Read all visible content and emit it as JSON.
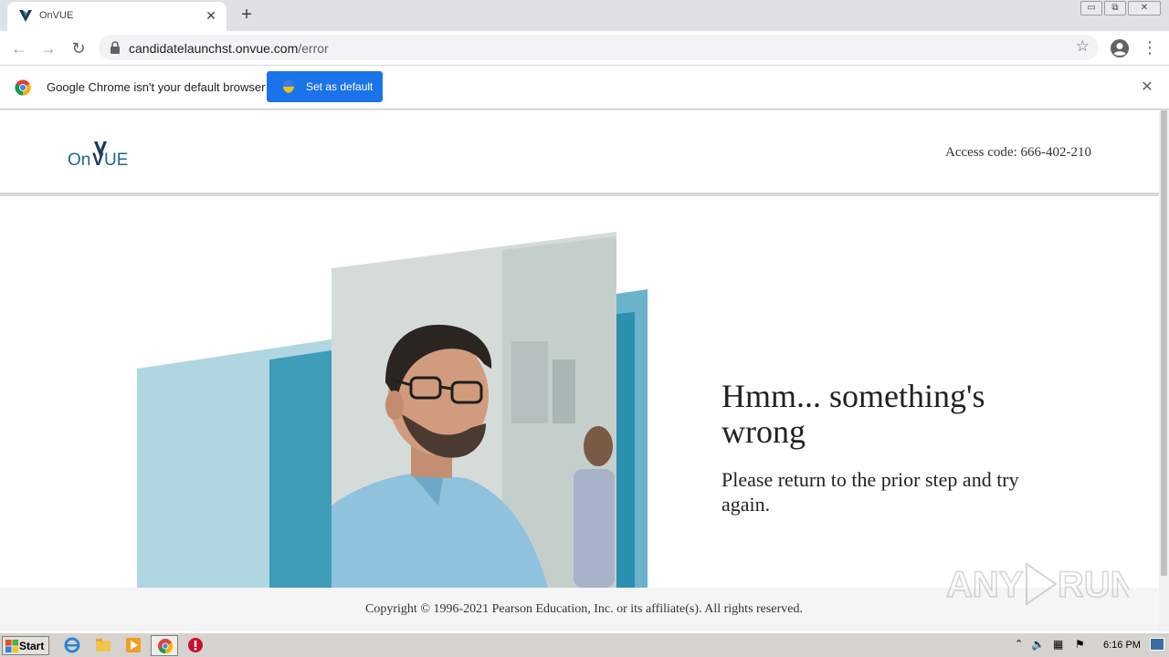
{
  "browser": {
    "tab_title": "OnVUE",
    "tab_close": "✕",
    "new_tab": "+",
    "url_host": "candidatelaunchst.onvue.com",
    "url_path": "/error",
    "infobar_message": "Google Chrome isn't your default browser",
    "set_default_label": "Set as default",
    "infobar_close": "✕"
  },
  "page": {
    "logo_text": "OnVUE",
    "access_code": "Access code: 666-402-210",
    "heading": "Hmm... something's wrong",
    "subheading": "Please return to the prior step and try again.",
    "copyright": "Copyright © 1996-2021 Pearson Education, Inc. or its affiliate(s). All rights reserved.",
    "watermark": "ANY RUN"
  },
  "taskbar": {
    "start_label": "Start",
    "clock": "6:16 PM"
  },
  "colors": {
    "brand_teal": "#1c6b8a",
    "brand_dark": "#1b3a57",
    "chrome_blue": "#1a73e8"
  }
}
